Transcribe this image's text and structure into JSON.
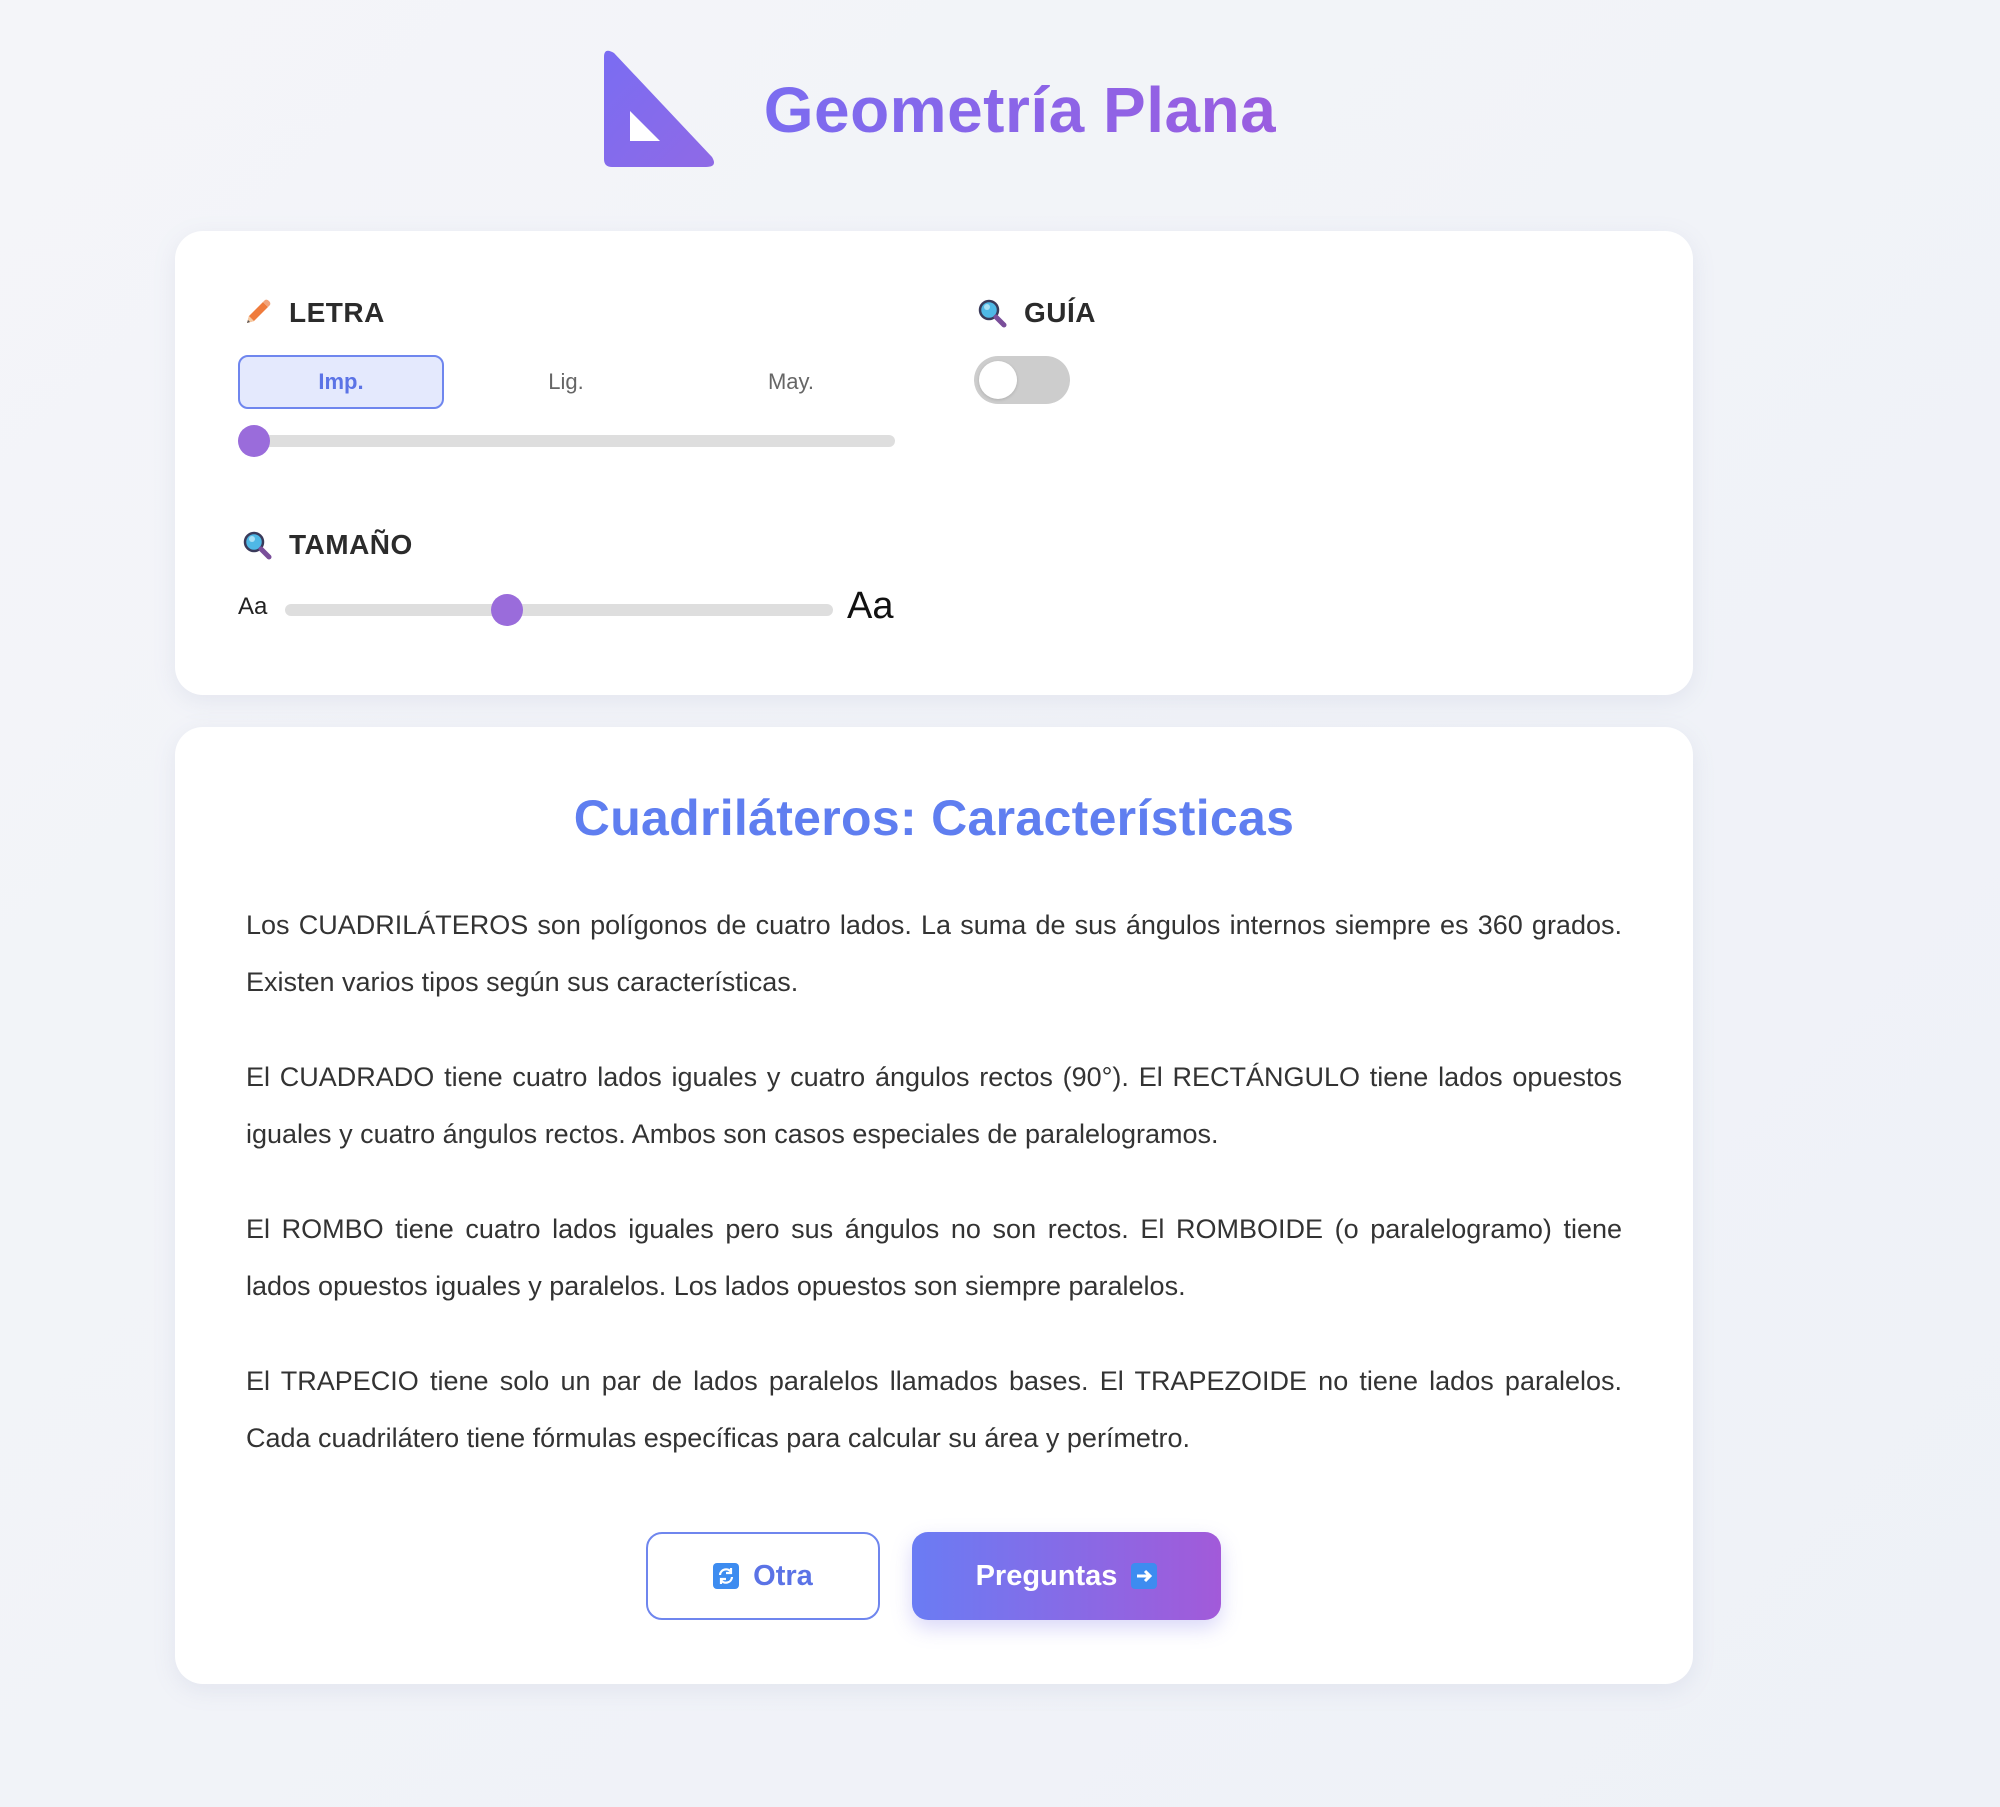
{
  "app": {
    "title": "Geometría Plana",
    "logo_icon": "set-square-triangle-icon"
  },
  "settings": {
    "letter": {
      "label": "LETRA",
      "icon": "pencil-icon",
      "options": [
        "Imp.",
        "Lig.",
        "May."
      ],
      "selected": "Imp.",
      "slider_position": 0
    },
    "guide": {
      "label": "GUÍA",
      "icon": "magnifier-icon",
      "enabled": false
    },
    "size": {
      "label": "TAMAÑO",
      "icon": "magnifier-icon",
      "small_label": "Aa",
      "large_label": "Aa",
      "slider_value": 0.4
    }
  },
  "content": {
    "title": "Cuadriláteros: Características",
    "paragraphs": [
      "Los CUADRILÁTEROS son polígonos de cuatro lados. La suma de sus ángulos internos siempre es 360 grados. Existen varios tipos según sus características.",
      "El CUADRADO tiene cuatro lados iguales y cuatro ángulos rectos (90°). El RECTÁNGULO tiene lados opuestos iguales y cuatro ángulos rectos. Ambos son casos especiales de paralelogramos.",
      "El ROMBO tiene cuatro lados iguales pero sus ángulos no son rectos. El ROMBOIDE (o paralelogramo) tiene lados opuestos iguales y paralelos. Los lados opuestos son siempre paralelos.",
      "El TRAPECIO tiene solo un par de lados paralelos llamados bases. El TRAPEZOIDE no tiene lados paralelos. Cada cuadrilátero tiene fórmulas específicas para calcular su área y perímetro."
    ],
    "buttons": {
      "other_label": "Otra",
      "other_icon": "refresh-icon",
      "questions_label": "Preguntas",
      "questions_icon": "arrow-right-icon"
    }
  },
  "colors": {
    "accent_blue": "#5f7ef0",
    "accent_purple": "#9a6cdb",
    "gradient_start": "#6a7cf4",
    "gradient_end": "#a25ad9"
  }
}
